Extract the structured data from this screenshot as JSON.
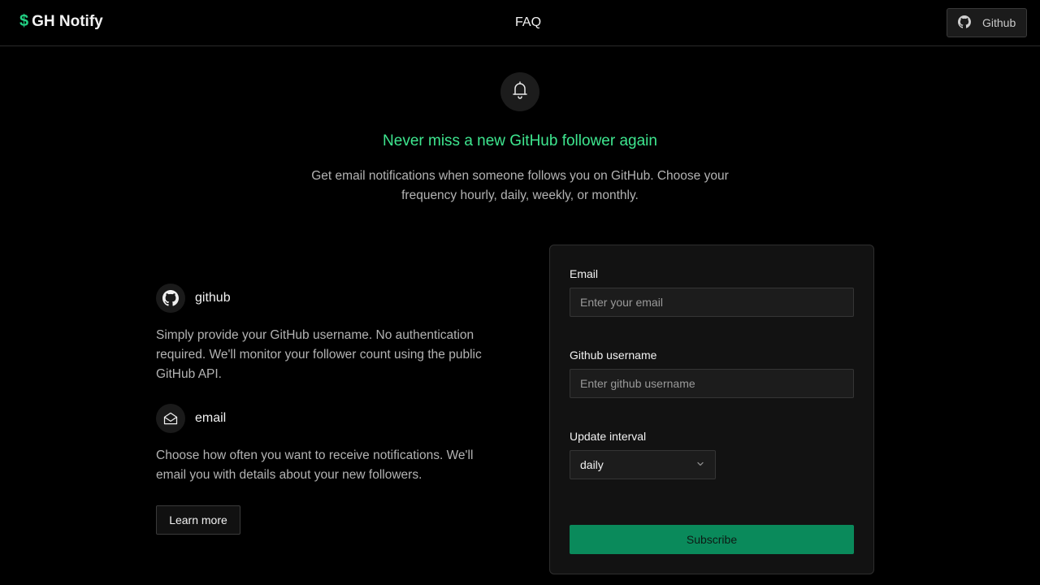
{
  "header": {
    "brand_symbol": "$",
    "brand_name": "GH Notify",
    "faq_label": "FAQ",
    "github_button_label": "Github"
  },
  "hero": {
    "title": "Never miss a new GitHub follower again",
    "subtitle": "Get email notifications when someone follows you on GitHub. Choose your frequency hourly, daily, weekly, or monthly."
  },
  "features": [
    {
      "label": "github",
      "icon": "github-icon",
      "text": "Simply provide your GitHub username. No authentication required. We'll monitor your follower count using the public GitHub API."
    },
    {
      "label": "email",
      "icon": "mail-open-icon",
      "text": "Choose how often you want to receive notifications. We'll email you with details about your new followers."
    }
  ],
  "learn_more_label": "Learn more",
  "form": {
    "email_label": "Email",
    "email_value": "",
    "email_placeholder": "Enter your email",
    "username_label": "Github username",
    "username_value": "",
    "username_placeholder": "Enter github username",
    "interval_label": "Update interval",
    "interval_selected": "daily",
    "submit_label": "Subscribe"
  },
  "colors": {
    "accent": "#3ee68f",
    "brand_dollar": "#22d083",
    "submit_bg": "#0a8a5b",
    "background": "#000000",
    "card_bg": "#121212"
  }
}
